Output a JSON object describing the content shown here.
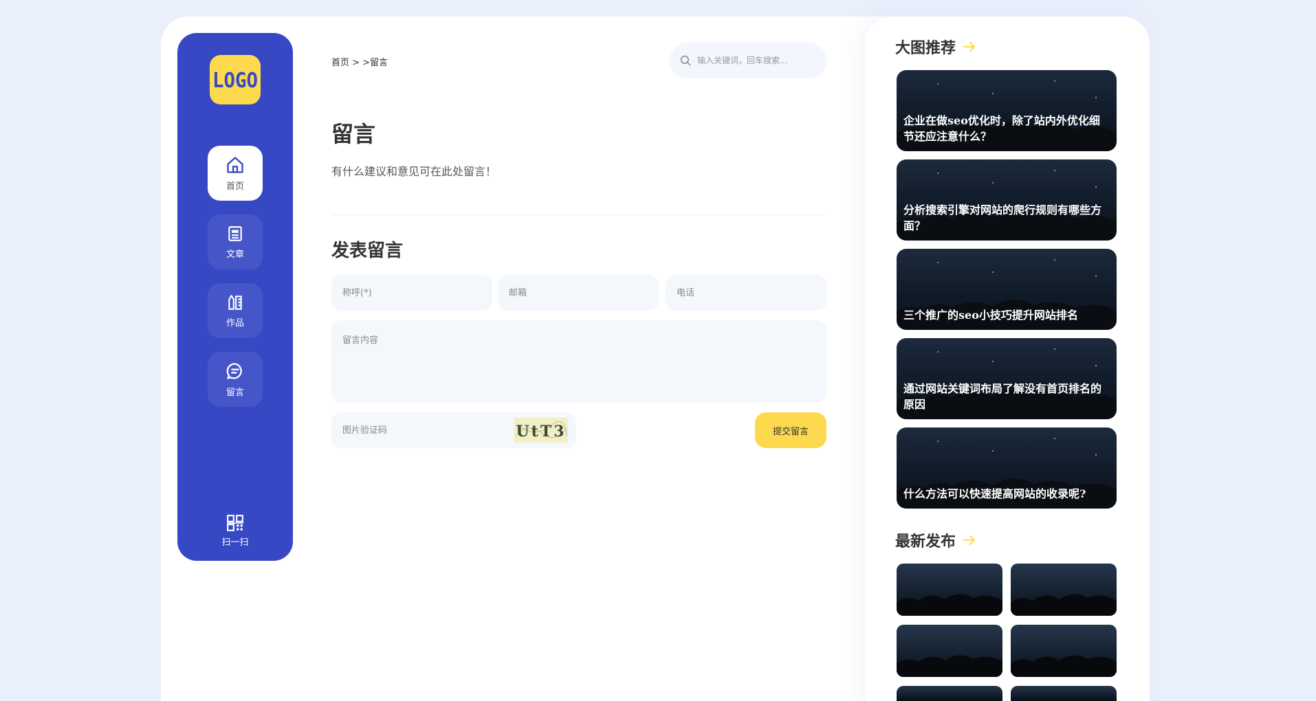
{
  "sidebar": {
    "logo_text": "LOGO",
    "items": [
      {
        "label": "首页",
        "icon": "home-icon",
        "active": true
      },
      {
        "label": "文章",
        "icon": "article-icon",
        "active": false
      },
      {
        "label": "作品",
        "icon": "works-icon",
        "active": false
      },
      {
        "label": "留言",
        "icon": "message-icon",
        "active": false
      }
    ],
    "scan_label": "扫一扫"
  },
  "header": {
    "breadcrumb": "首页 > >留言",
    "search_placeholder": "输入关键词，回车搜索..."
  },
  "main": {
    "title": "留言",
    "description": "有什么建议和意见可在此处留言！",
    "form_title": "发表留言",
    "name_placeholder": "称呼(*)",
    "email_placeholder": "邮箱",
    "phone_placeholder": "电话",
    "content_placeholder": "留言内容",
    "captcha_placeholder": "图片验证码",
    "captcha_text": "UtT3",
    "submit_label": "提交留言"
  },
  "right": {
    "featured_title": "大图推荐",
    "featured": [
      "企业在做seo优化时，除了站内外优化细节还应注意什么？",
      "分析搜索引擎对网站的爬行规则有哪些方面？",
      "三个推广的seo小技巧提升网站排名",
      "通过网站关键词布局了解没有首页排名的原因",
      "什么方法可以快速提高网站的收录呢?"
    ],
    "latest_title": "最新发布"
  },
  "colors": {
    "sidebar": "#3748c4",
    "accent": "#fdd94e",
    "background": "#e9effb"
  }
}
